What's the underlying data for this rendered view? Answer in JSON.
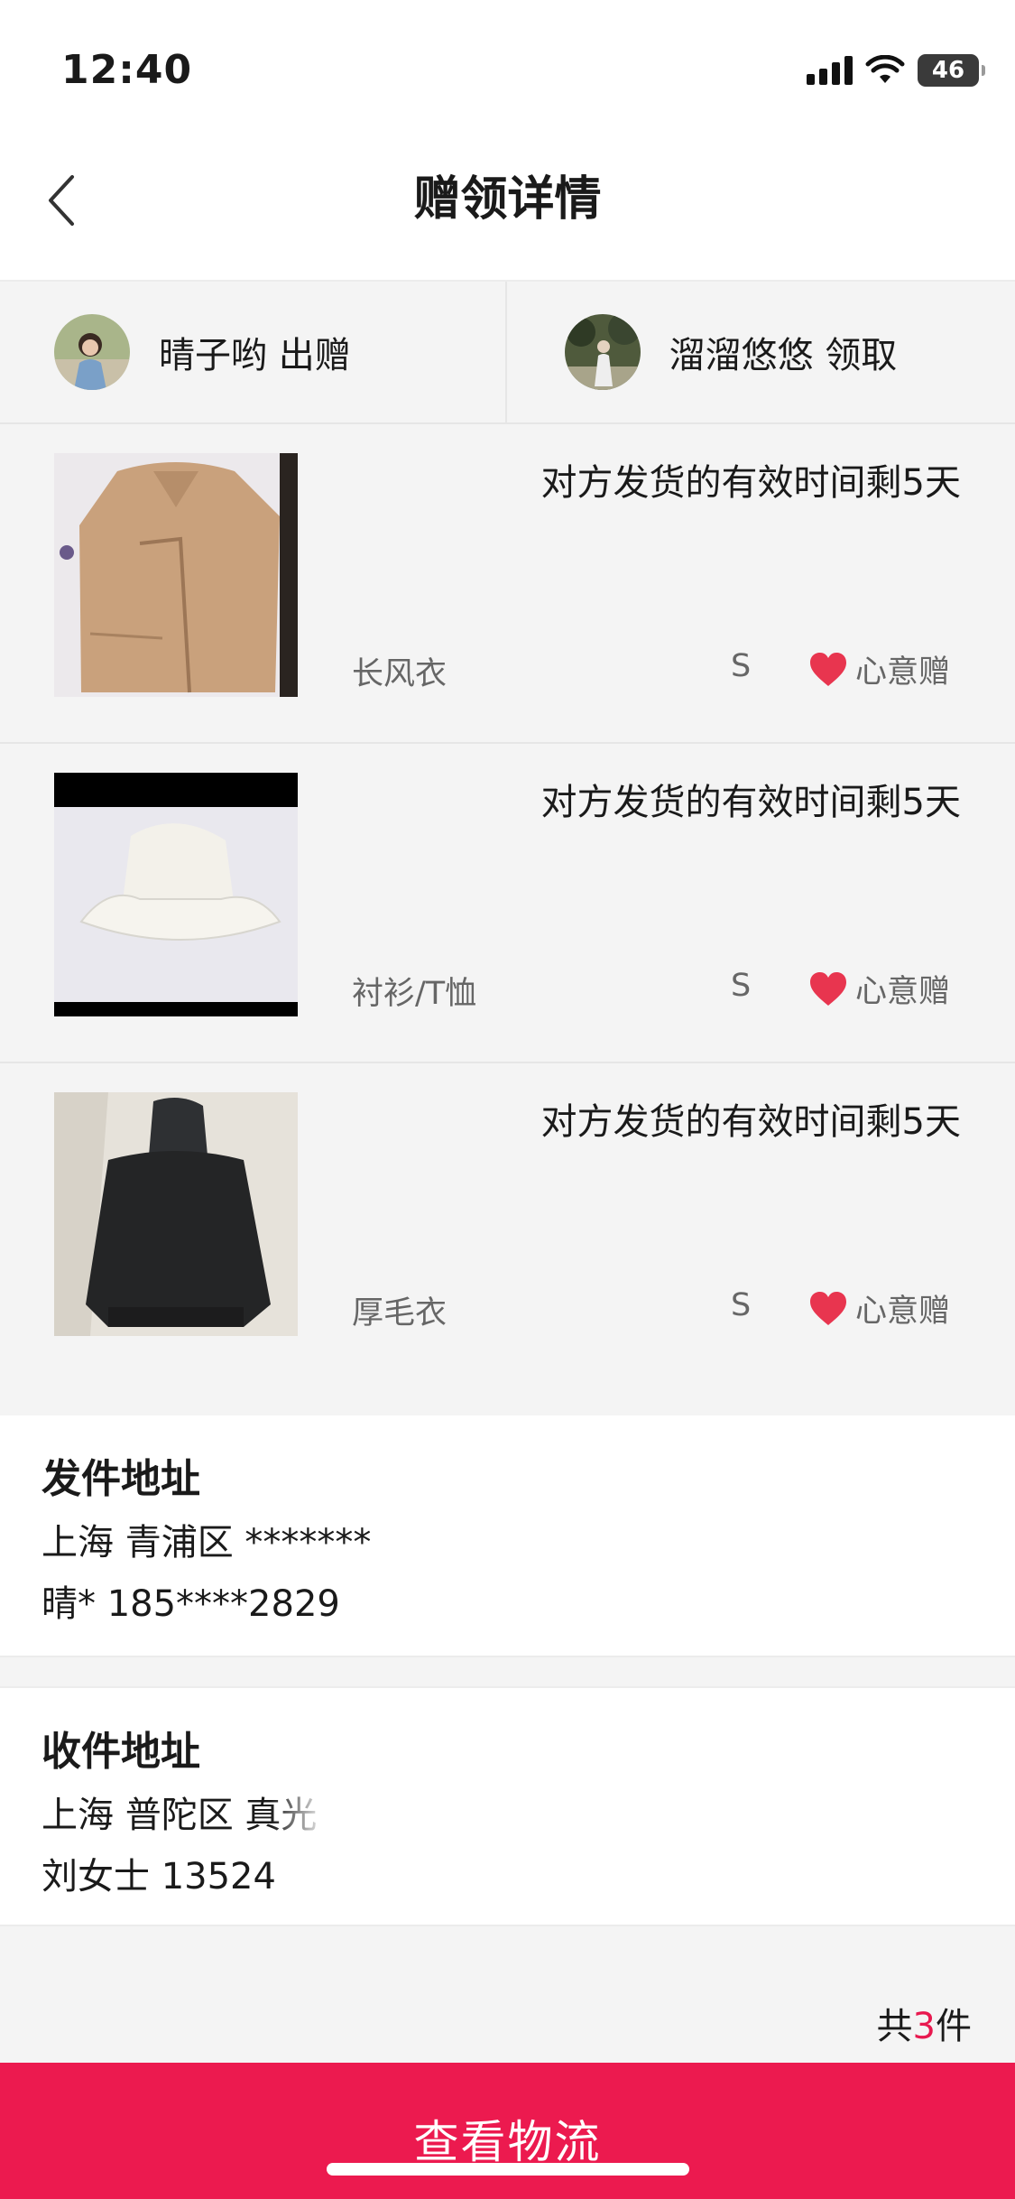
{
  "status_bar": {
    "time": "12:40",
    "battery": "46"
  },
  "nav": {
    "title": "赠领详情"
  },
  "users": {
    "giver": {
      "text": "晴子哟 出赠"
    },
    "receiver": {
      "text": "溜溜悠悠 领取"
    }
  },
  "items": [
    {
      "ship_time": "对方发货的有效时间剩5天",
      "name": "长风衣",
      "size": "S",
      "badge": "心意赠"
    },
    {
      "ship_time": "对方发货的有效时间剩5天",
      "name": "衬衫/T恤",
      "size": "S",
      "badge": "心意赠"
    },
    {
      "ship_time": "对方发货的有效时间剩5天",
      "name": "厚毛衣",
      "size": "S",
      "badge": "心意赠"
    }
  ],
  "send_address": {
    "title": "发件地址",
    "line1": "上海 青浦区 *******",
    "line2": "晴* 185****2829"
  },
  "receive_address": {
    "title": "收件地址",
    "line1": "上海 普陀区 真光",
    "line2": "刘女士 13524"
  },
  "total": {
    "prefix": "共",
    "count": "3",
    "suffix": "件"
  },
  "bottom_button": {
    "label": "查看物流"
  },
  "colors": {
    "accent": "#ec1a4f",
    "heart": "#e8354f"
  }
}
